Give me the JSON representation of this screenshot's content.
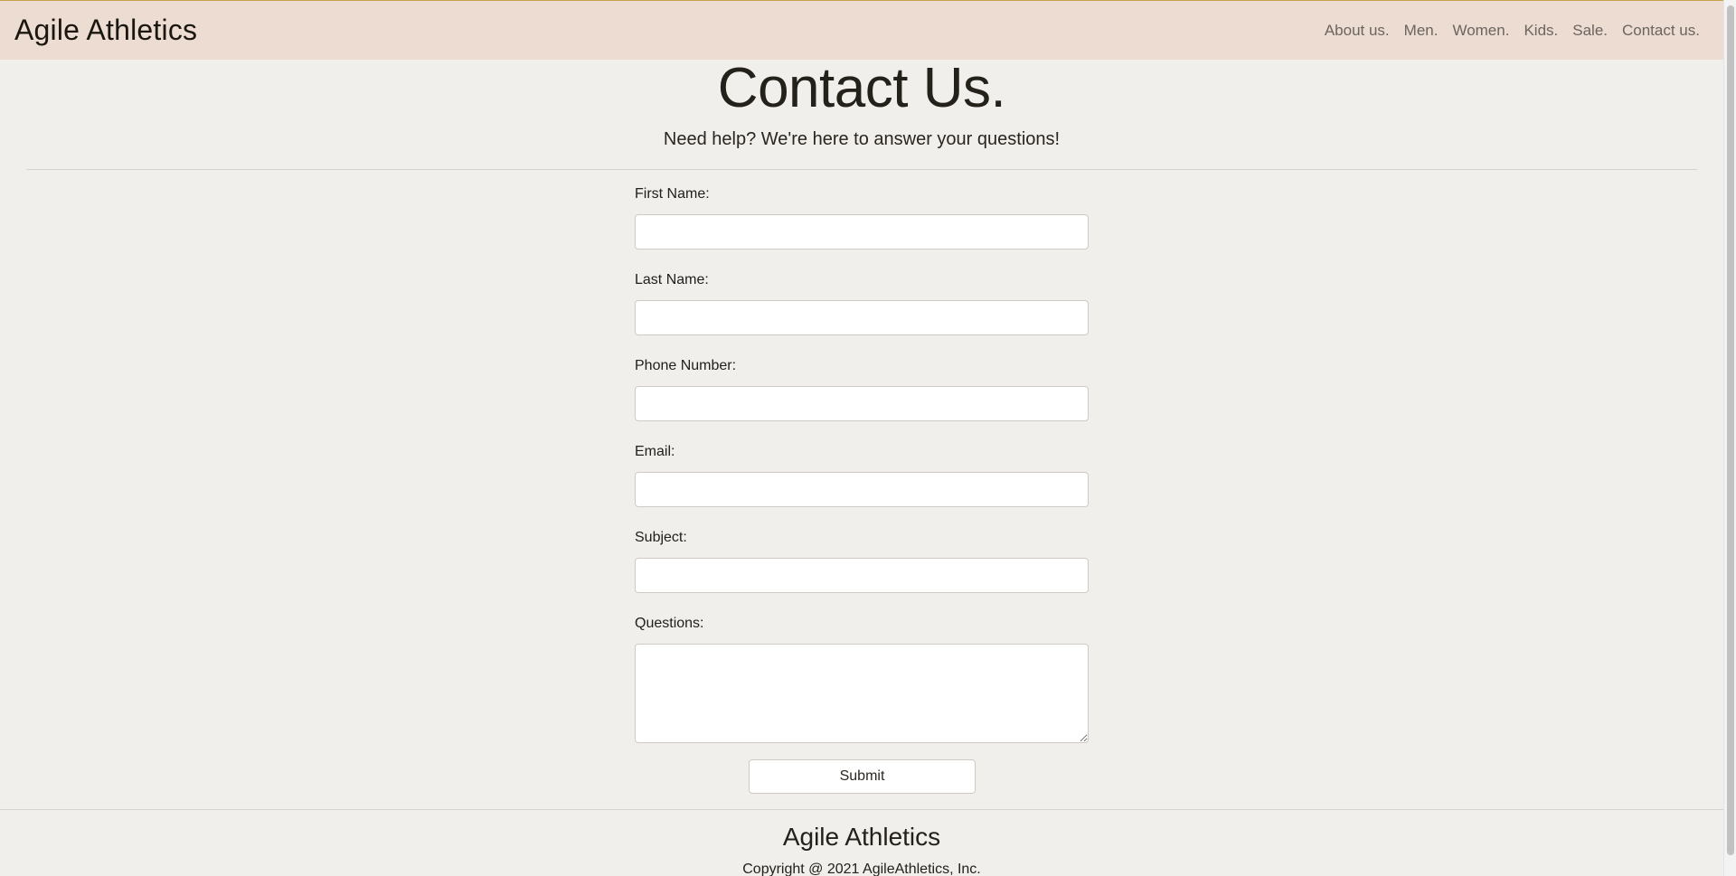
{
  "header": {
    "brand": "Agile Athletics",
    "nav": [
      "About us.",
      "Men.",
      "Women.",
      "Kids.",
      "Sale.",
      "Contact us."
    ]
  },
  "hero": {
    "title": "Contact Us.",
    "subtitle": "Need help? We're here to answer your questions!"
  },
  "form": {
    "fields": [
      {
        "label": "First Name:",
        "value": ""
      },
      {
        "label": "Last Name:",
        "value": ""
      },
      {
        "label": "Phone Number:",
        "value": ""
      },
      {
        "label": "Email:",
        "value": ""
      },
      {
        "label": "Subject:",
        "value": ""
      },
      {
        "label": "Questions:",
        "value": ""
      }
    ],
    "submit_label": "Submit"
  },
  "footer": {
    "brand": "Agile Athletics",
    "copyright": "Copyright @ 2021 AgileAthletics, Inc."
  },
  "colors": {
    "navbar_bg": "#ecdcd1",
    "page_bg": "#f0efeb",
    "accent_line": "#c9a24a"
  }
}
